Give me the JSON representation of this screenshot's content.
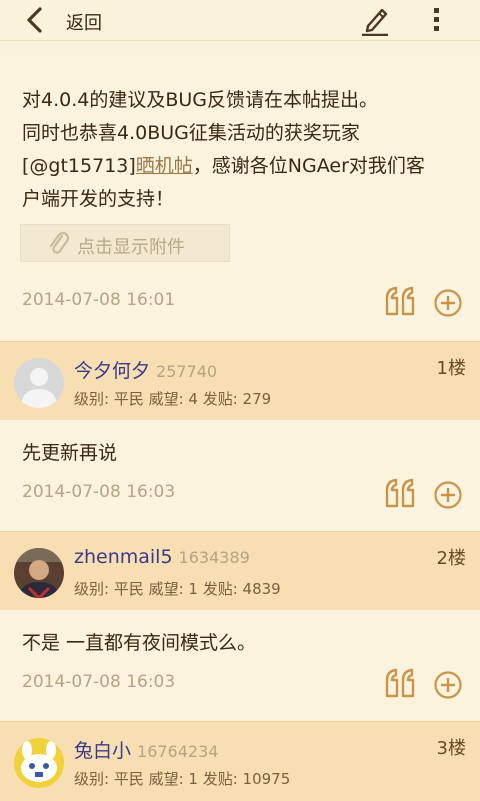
{
  "topbar": {
    "back_label": "返回"
  },
  "main_post": {
    "line1": "对4.0.4的建议及BUG反馈请在本帖提出。",
    "line2": "同时也恭喜4.0BUG征集活动的获奖玩家",
    "line3_prefix": "[@gt15713]",
    "line3_link": "晒机帖",
    "line3_suffix": "，感谢各位NGAer对我们客",
    "line4": "户端开发的支持！",
    "attach_label": "点击显示附件",
    "date": "2014-07-08 16:01"
  },
  "floors": [
    {
      "name": "今夕何夕",
      "uid": "257740",
      "stats": "级别: 平民  威望: 4  发贴: 279",
      "floor": "1楼",
      "text": "先更新再说",
      "date": "2014-07-08 16:03"
    },
    {
      "name": "zhenmail5",
      "uid": "1634389",
      "stats": "级别: 平民  威望: 1  发贴: 4839",
      "floor": "2楼",
      "text": "不是 一直都有夜间模式么。",
      "date": "2014-07-08 16:03"
    },
    {
      "name": "兔白小",
      "uid": "16764234",
      "stats": "级别: 平民  威望: 1  发贴: 10975",
      "floor": "3楼"
    }
  ],
  "colors": {
    "accent": "#c8954a",
    "background": "#fbf2dc",
    "floor_header": "#f7dfb3"
  }
}
